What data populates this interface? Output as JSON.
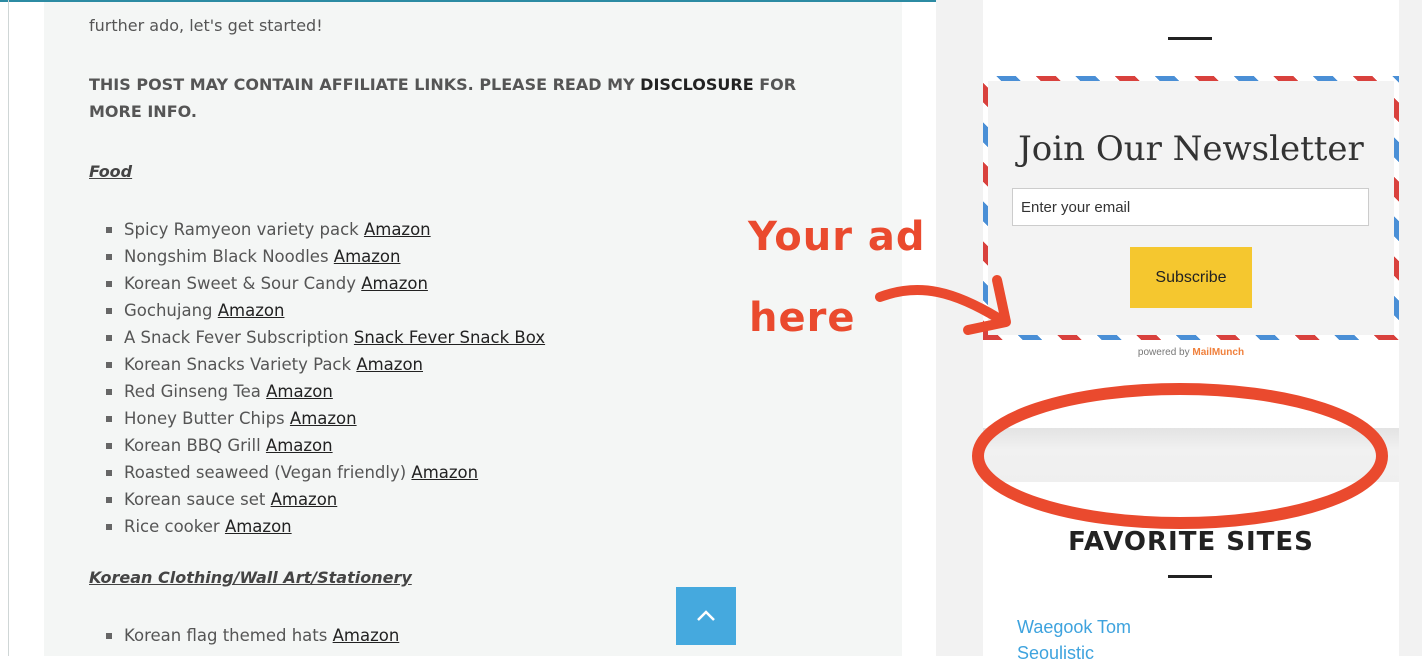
{
  "article": {
    "intro_tail": "further ado, let's get started!",
    "disclaimer_pre": "THIS POST MAY CONTAIN AFFILIATE LINKS. PLEASE READ MY ",
    "disclaimer_link": "DISCLOSURE",
    "disclaimer_post": " FOR MORE INFO.",
    "food_heading": "Food",
    "food_items": [
      {
        "text": "Spicy Ramyeon variety pack ",
        "link": "Amazon"
      },
      {
        "text": "Nongshim Black Noodles ",
        "link": "Amazon"
      },
      {
        "text": "Korean Sweet & Sour Candy ",
        "link": "Amazon"
      },
      {
        "text": "Gochujang ",
        "link": "Amazon"
      },
      {
        "text": "A Snack Fever Subscription ",
        "link": "Snack Fever Snack Box"
      },
      {
        "text": "Korean Snacks Variety Pack ",
        "link": "Amazon"
      },
      {
        "text": "Red Ginseng Tea ",
        "link": "Amazon"
      },
      {
        "text": "Honey Butter Chips ",
        "link": "Amazon"
      },
      {
        "text": "Korean BBQ Grill ",
        "link": "Amazon"
      },
      {
        "text": "Roasted seaweed (Vegan friendly) ",
        "link": "Amazon"
      },
      {
        "text": "Korean sauce set ",
        "link": "Amazon"
      },
      {
        "text": "Rice cooker ",
        "link": "Amazon"
      }
    ],
    "clothing_heading": "Korean Clothing/Wall Art/Stationery",
    "clothing_items": [
      {
        "text": "Korean flag themed hats ",
        "link": "Amazon"
      }
    ]
  },
  "sidebar": {
    "newsletter": {
      "title": "Join Our Newsletter",
      "email_placeholder": "Enter your email",
      "subscribe_label": "Subscribe",
      "powered_by": "powered by ",
      "powered_brand": "MailMunch"
    },
    "favorites": {
      "title": "FAVORITE SITES",
      "links": [
        "Waegook Tom",
        "Seoulistic"
      ]
    }
  },
  "annotation": {
    "line1": "Your ad",
    "line2": "here",
    "color": "#ea4a2e"
  },
  "icons": {
    "to_top": "chevron-up-icon"
  },
  "colors": {
    "accent_blue": "#45a9de",
    "button_yellow": "#f5c72f",
    "link_blue": "#3ea3de"
  }
}
